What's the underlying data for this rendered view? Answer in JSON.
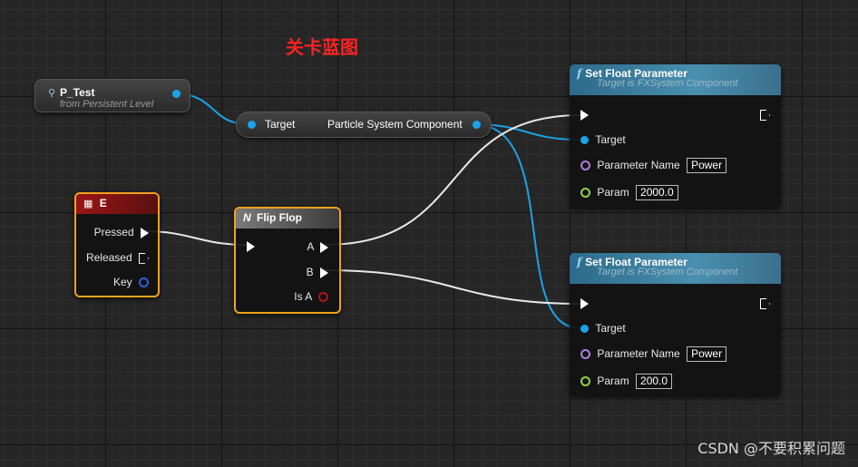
{
  "canvas": {
    "title": "关卡蓝图"
  },
  "p_test": {
    "name": "P_Test",
    "subtitle": "from Persistent Level"
  },
  "getter": {
    "input_label": "Target",
    "output_label": "Particle System Component"
  },
  "key_event": {
    "title": "E",
    "pins": {
      "pressed": "Pressed",
      "released": "Released",
      "key": "Key"
    }
  },
  "flip_flop": {
    "title": "Flip Flop",
    "pins": {
      "a": "A",
      "b": "B",
      "is_a": "Is A"
    }
  },
  "set_float_1": {
    "title": "Set Float Parameter",
    "subtitle": "Target is FXSystem Component",
    "target_label": "Target",
    "param_name_label": "Parameter Name",
    "param_name_value": "Power",
    "param_label": "Param",
    "param_value": "2000.0"
  },
  "set_float_2": {
    "title": "Set Float Parameter",
    "subtitle": "Target is FXSystem Component",
    "target_label": "Target",
    "param_name_label": "Parameter Name",
    "param_name_value": "Power",
    "param_label": "Param",
    "param_value": "200.0"
  },
  "watermark": "CSDN @不要积累问题",
  "colors": {
    "object_pin": "#1aa3e8",
    "name_pin": "#b37ee0",
    "float_pin": "#8fd44a",
    "bool_pin": "#b01818",
    "exec_pin": "#ffffff",
    "selection": "#f0a21c",
    "title_text": "#ff2222"
  }
}
